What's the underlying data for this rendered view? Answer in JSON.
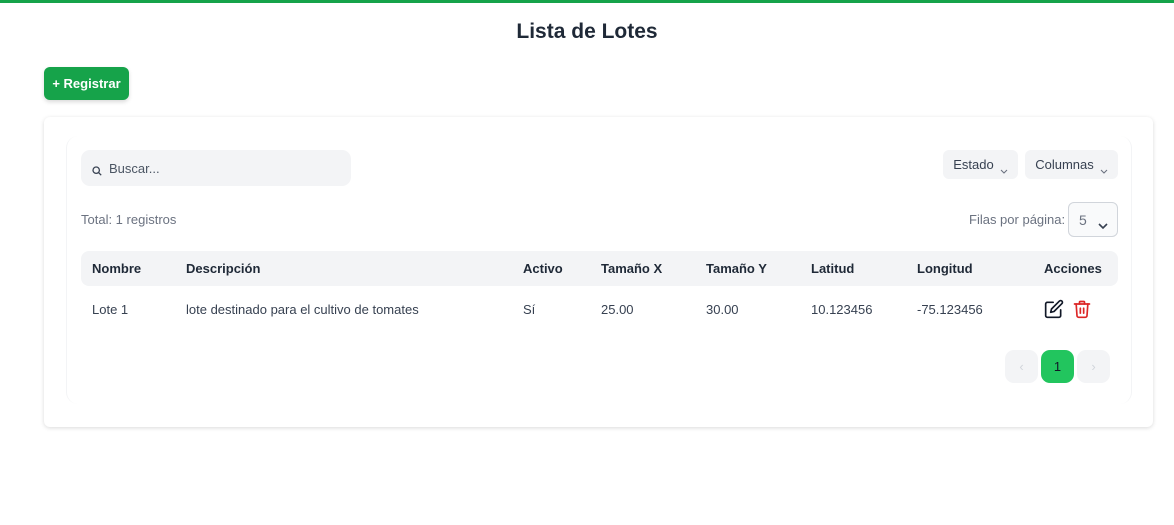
{
  "header": {
    "title": "Lista de Lotes"
  },
  "toolbar": {
    "register_label": "+ Registrar"
  },
  "search": {
    "placeholder": "Buscar..."
  },
  "filters": {
    "estado_label": "Estado",
    "columnas_label": "Columnas"
  },
  "summary": {
    "total_text": "Total: 1 registros",
    "rows_per_page_label": "Filas por página:",
    "rows_per_page_value": "5"
  },
  "table": {
    "headers": [
      "Nombre",
      "Descripción",
      "Activo",
      "Tamaño X",
      "Tamaño Y",
      "Latitud",
      "Longitud",
      "Acciones"
    ],
    "rows": [
      {
        "nombre": "Lote 1",
        "descripcion": "lote destinado para el cultivo de tomates",
        "activo": "Sí",
        "tamano_x": "25.00",
        "tamano_y": "30.00",
        "latitud": "10.123456",
        "longitud": "-75.123456"
      }
    ]
  },
  "pagination": {
    "prev": "‹",
    "current": "1",
    "next": "›"
  },
  "icons": {
    "search": "search-icon",
    "edit": "edit-icon",
    "delete": "trash-icon",
    "chevron": "chevron-down-icon"
  },
  "colors": {
    "accent": "#16a34a",
    "current_page": "#22c55e",
    "delete": "#dc2626"
  }
}
